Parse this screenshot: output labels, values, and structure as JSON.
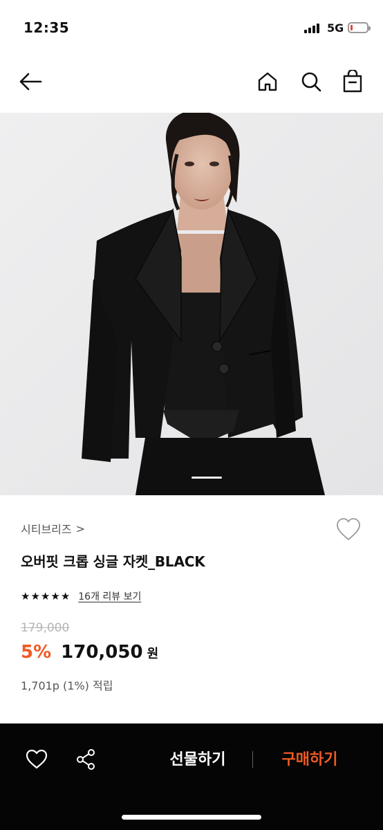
{
  "status_bar": {
    "time": "12:35",
    "network": "5G",
    "battery_level": 0.15,
    "battery_color": "#e0463c"
  },
  "nav": {
    "back_icon": "arrow-left-icon",
    "home_icon": "home-icon",
    "search_icon": "search-icon",
    "cart_icon": "shopping-bag-icon"
  },
  "product": {
    "brand": "시티브리즈",
    "brand_chevron": ">",
    "name": "오버핏 크롭 싱글 자켓_BLACK",
    "rating": 5,
    "review_link": "16개 리뷰 보기",
    "original_price": "179,000",
    "discount": "5%",
    "sale_price": "170,050",
    "currency": "원",
    "points": "1,701p (1%) 적립",
    "accent_color": "#f05a24"
  },
  "bottom_bar": {
    "wish_icon": "heart-icon",
    "share_icon": "share-icon",
    "gift_label": "선물하기",
    "buy_label": "구매하기"
  }
}
